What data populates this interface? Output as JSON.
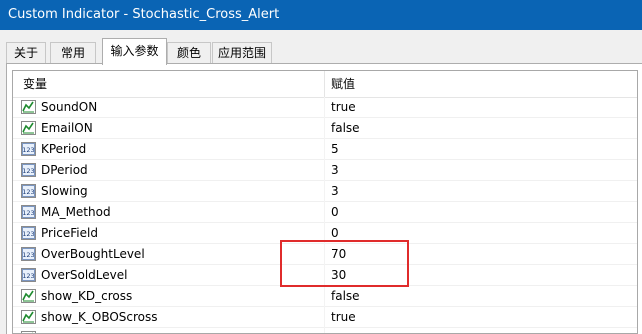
{
  "window": {
    "title": "Custom Indicator - Stochastic_Cross_Alert"
  },
  "tabs": [
    {
      "label": "关于"
    },
    {
      "label": "常用"
    },
    {
      "label": "输入参数"
    },
    {
      "label": "颜色"
    },
    {
      "label": "应用范围"
    }
  ],
  "grid": {
    "columns": {
      "variable": "变量",
      "value": "赋值"
    },
    "rows": [
      {
        "icon": "bool-toggle-icon",
        "name": "SoundON",
        "value": "true"
      },
      {
        "icon": "bool-toggle-icon",
        "name": "EmailON",
        "value": "false"
      },
      {
        "icon": "numeric-123-icon",
        "name": "KPeriod",
        "value": "5"
      },
      {
        "icon": "numeric-123-icon",
        "name": "DPeriod",
        "value": "3"
      },
      {
        "icon": "numeric-123-icon",
        "name": "Slowing",
        "value": "3"
      },
      {
        "icon": "numeric-123-icon",
        "name": "MA_Method",
        "value": "0"
      },
      {
        "icon": "numeric-123-icon",
        "name": "PriceField",
        "value": "0"
      },
      {
        "icon": "numeric-123-icon",
        "name": "OverBoughtLevel",
        "value": "70"
      },
      {
        "icon": "numeric-123-icon",
        "name": "OverSoldLevel",
        "value": "30"
      },
      {
        "icon": "bool-toggle-icon",
        "name": "show_KD_cross",
        "value": "false"
      },
      {
        "icon": "bool-toggle-icon",
        "name": "show_K_OBOScross",
        "value": "true"
      },
      {
        "icon": "bool-toggle-icon",
        "name": "",
        "value": ""
      }
    ]
  },
  "colors": {
    "titlebar": "#0a64b4",
    "highlight": "#e02b2b"
  }
}
